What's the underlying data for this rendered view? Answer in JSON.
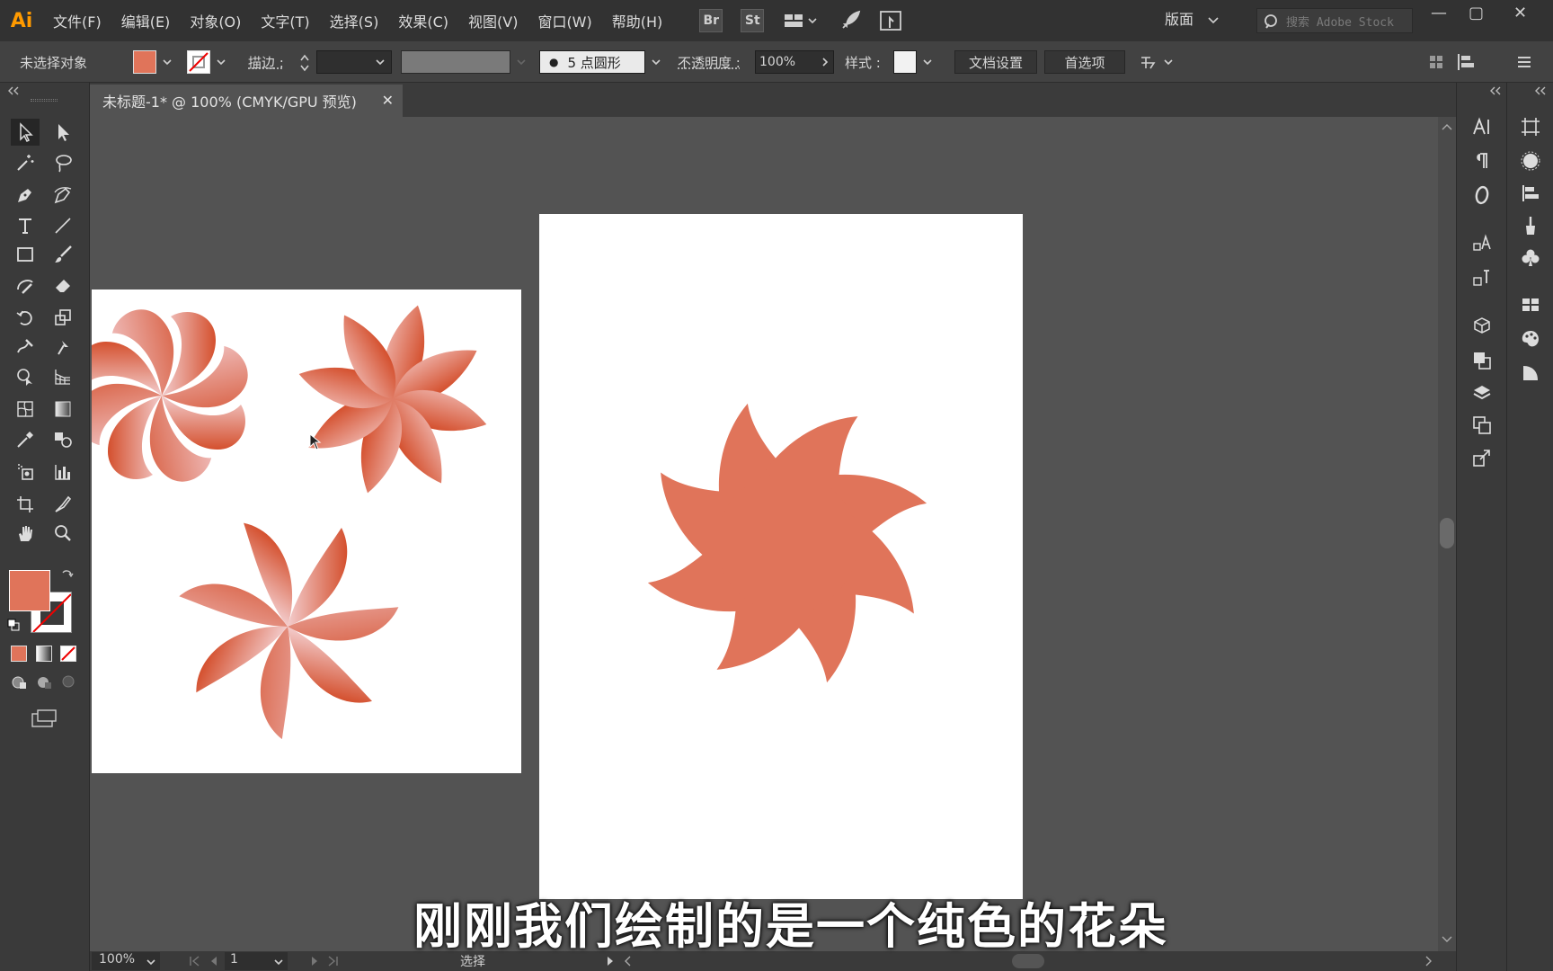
{
  "app": {
    "logo": "Ai",
    "accent": "#ff9a00"
  },
  "menu": [
    "文件(F)",
    "编辑(E)",
    "对象(O)",
    "文字(T)",
    "选择(S)",
    "效果(C)",
    "视图(V)",
    "窗口(W)",
    "帮助(H)"
  ],
  "bridge": {
    "br": "Br",
    "st": "St"
  },
  "workspace_label": "版面",
  "search_placeholder": "搜索 Adobe Stock",
  "window_controls": {
    "minimize": "—",
    "maximize": "▢",
    "close": "✕"
  },
  "control_bar": {
    "selection_status": "未选择对象",
    "stroke_label": "描边 :",
    "brush_label": "5 点圆形",
    "opacity_label": "不透明度 :",
    "opacity_value": "100%",
    "style_label": "样式 :",
    "doc_setup": "文档设置",
    "preferences": "首选项",
    "fill_color": "#e0745a"
  },
  "document_tab": {
    "title": "未标题-1* @ 100% (CMYK/GPU 预览)",
    "close": "✕"
  },
  "status_bar": {
    "zoom": "100%",
    "page": "1",
    "tool": "选择"
  },
  "subtitle": "刚刚我们绘制的是一个纯色的花朵",
  "colors": {
    "flower": "#e0745a",
    "flower_dark": "#d4502e",
    "flower_light": "#f1c3c3"
  },
  "icons": [
    "selection-icon",
    "direct-selection-icon",
    "magic-wand-icon",
    "lasso-icon",
    "pen-icon",
    "curvature-icon",
    "type-icon",
    "line-icon",
    "rectangle-icon",
    "paintbrush-icon",
    "shaper-icon",
    "eraser-icon",
    "rotate-icon",
    "scale-icon",
    "warp-icon",
    "puppet-warp-icon",
    "shape-builder-icon",
    "perspective-icon",
    "mesh-icon",
    "gradient-icon",
    "eyedropper-icon",
    "blend-icon",
    "symbol-sprayer-icon",
    "column-graph-icon",
    "artboard-icon",
    "slice-icon",
    "hand-icon",
    "zoom-icon"
  ]
}
